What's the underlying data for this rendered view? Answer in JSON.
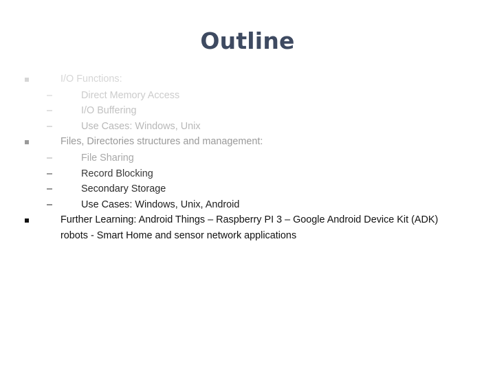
{
  "slide": {
    "title": "Outline",
    "title_color": "#3e4a61",
    "background_color": "#ffffff",
    "bullets": [
      {
        "marker": "square-bullet",
        "marker_glyph": "▪",
        "text": "I/O Functions:",
        "color": "#d6d6d6",
        "children": [
          {
            "marker_glyph": "–",
            "text": "Direct Memory Access",
            "color": "#cccccc"
          },
          {
            "marker_glyph": "–",
            "text": "I/O Buffering",
            "color": "#c2c2c2"
          },
          {
            "marker_glyph": "–",
            "text": "Use Cases: Windows, Unix",
            "color": "#b8b8b8"
          }
        ]
      },
      {
        "marker": "square-bullet",
        "marker_glyph": "▪",
        "text": "Files, Directories structures and management:",
        "color": "#9a9a9a",
        "children": [
          {
            "marker_glyph": "–",
            "text": "File Sharing",
            "color": "#a8a8a8"
          },
          {
            "marker_glyph": "–",
            "text": "Record Blocking",
            "color": "#3a3a3a"
          },
          {
            "marker_glyph": "–",
            "text": "Secondary Storage",
            "color": "#2b2b2b"
          },
          {
            "marker_glyph": "–",
            "text": "Use Cases: Windows, Unix, Android",
            "color": "#1c1c1c"
          }
        ]
      },
      {
        "marker": "square-bullet",
        "marker_glyph": "▪",
        "text": "Further Learning: Android Things – Raspberry PI 3 – Google Android Device Kit (ADK) robots  - Smart Home and sensor network applications",
        "color": "#111111",
        "children": []
      }
    ]
  }
}
